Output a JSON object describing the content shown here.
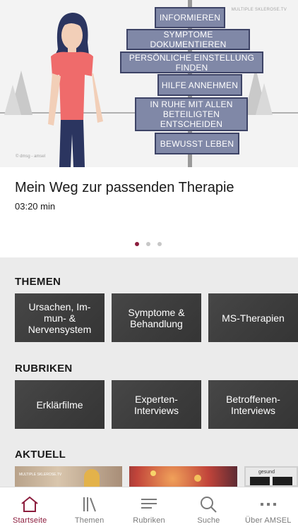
{
  "hero": {
    "watermark": "MULTIPLE SKLEROSE.TV",
    "credit": "© dmsg - amsel",
    "signs": [
      "INFORMIEREN",
      "SYMPTOME DOKUMENTIEREN",
      "PERSÖNLICHE EINSTELLUNG FINDEN",
      "HILFE ANNEHMEN",
      "IN RUHE MIT ALLEN\nBETEILIGTEN ENTSCHEIDEN",
      "BEWUSST LEBEN"
    ]
  },
  "featured": {
    "title": "Mein Weg zur passenden Therapie",
    "duration": "03:20 min",
    "carousel": {
      "count": 3,
      "active_index": 0
    }
  },
  "themen": {
    "title": "THEMEN",
    "tiles": [
      "Ursachen, Im-\nmun- &\nNervensystem",
      "Symptome &\nBehandlung",
      "MS-Therapien"
    ]
  },
  "rubriken": {
    "title": "RUBRIKEN",
    "tiles": [
      "Erklärfilme",
      "Experten-\nInterviews",
      "Betroffenen-\nInterviews"
    ]
  },
  "aktuell": {
    "title": "AKTUELL",
    "items": [
      {
        "caption": "MULTIPLE SKLEROSE.TV"
      },
      {
        "caption": ""
      },
      {
        "caption": "gesund"
      }
    ]
  },
  "tabbar": {
    "tabs": [
      {
        "label": "Startseite",
        "icon": "home-icon",
        "active": true
      },
      {
        "label": "Themen",
        "icon": "books-icon",
        "active": false
      },
      {
        "label": "Rubriken",
        "icon": "list-icon",
        "active": false
      },
      {
        "label": "Suche",
        "icon": "search-icon",
        "active": false
      },
      {
        "label": "Über AMSEL",
        "icon": "more-icon",
        "active": false
      }
    ]
  },
  "colors": {
    "accent": "#8c1d3d",
    "tile": "#3f3f3f",
    "sign": "#8088a7"
  }
}
